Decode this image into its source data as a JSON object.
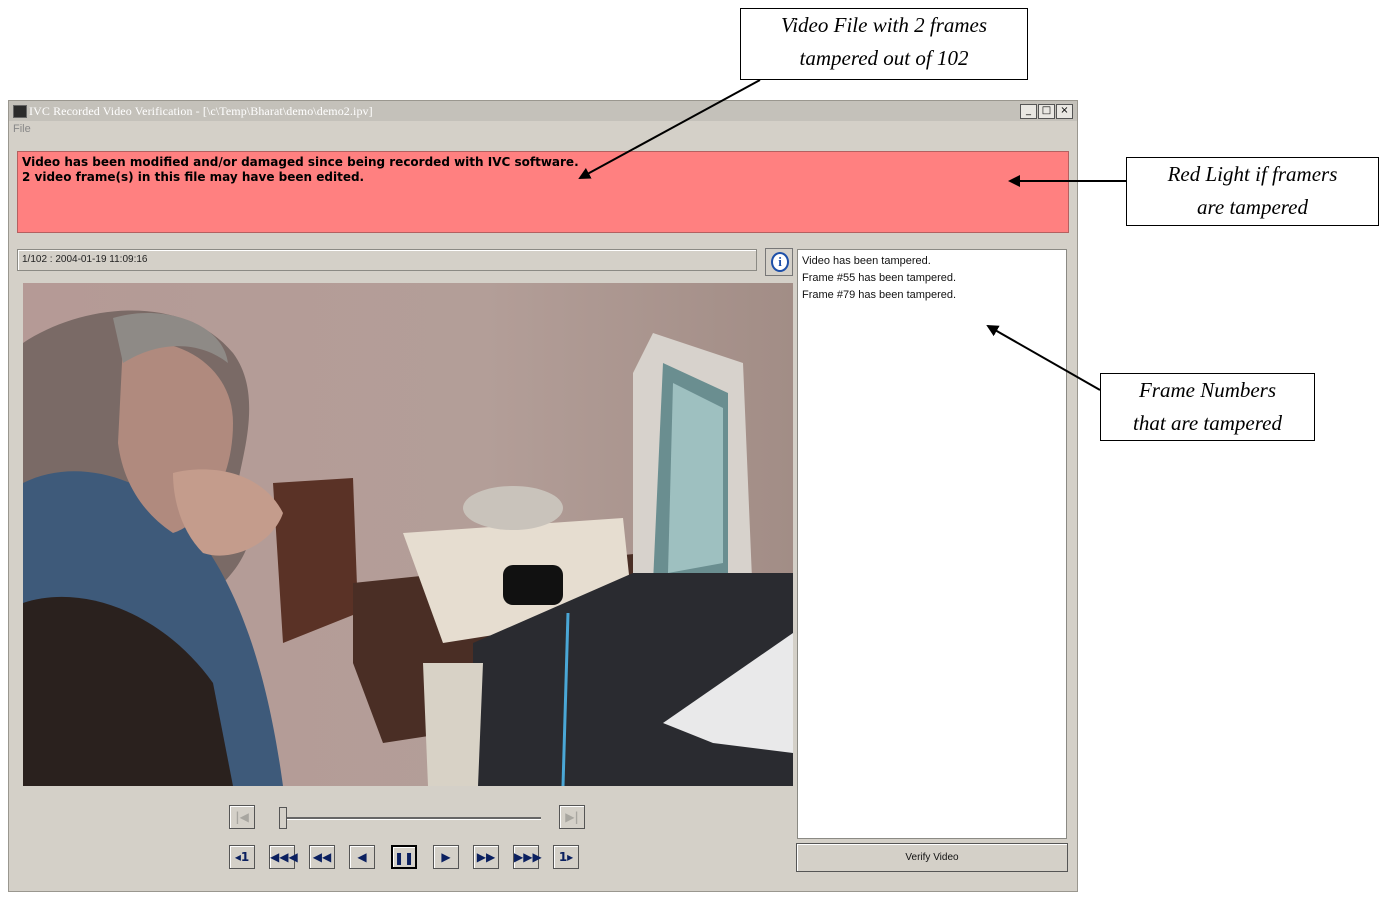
{
  "callouts": {
    "tamper_count": [
      "Video File with 2 frames",
      "tampered out of 102"
    ],
    "red_light": [
      "Red Light if framers",
      "are tampered"
    ],
    "frame_numbers": [
      "Frame Numbers",
      "that are tampered"
    ]
  },
  "window": {
    "title": "IVC Recorded Video Verification - [\\c\\Temp\\Bharat\\demo\\demo2.ipv]",
    "menu_file": "File",
    "min_icon": "minimize-icon",
    "max_icon": "maximize-icon",
    "close_icon": "close-icon"
  },
  "alert": {
    "line1": "Video has been modified and/or damaged since being recorded with IVC software.",
    "line2": "2 video frame(s) in this file may have been edited.",
    "color": "#ff8080"
  },
  "frame_status": "1/102 :  2004-01-19 11:09:16",
  "info_button": "i",
  "log": [
    "Video has been tampered.",
    "Frame #55 has been tampered.",
    "Frame #79 has been tampered."
  ],
  "verify_button": "Verify Video",
  "playback": {
    "position_fraction": 0.0,
    "buttons": [
      "step-back",
      "fast-rewind",
      "rewind",
      "play-reverse",
      "pause",
      "play",
      "forward",
      "fast-forward",
      "step-forward"
    ]
  }
}
